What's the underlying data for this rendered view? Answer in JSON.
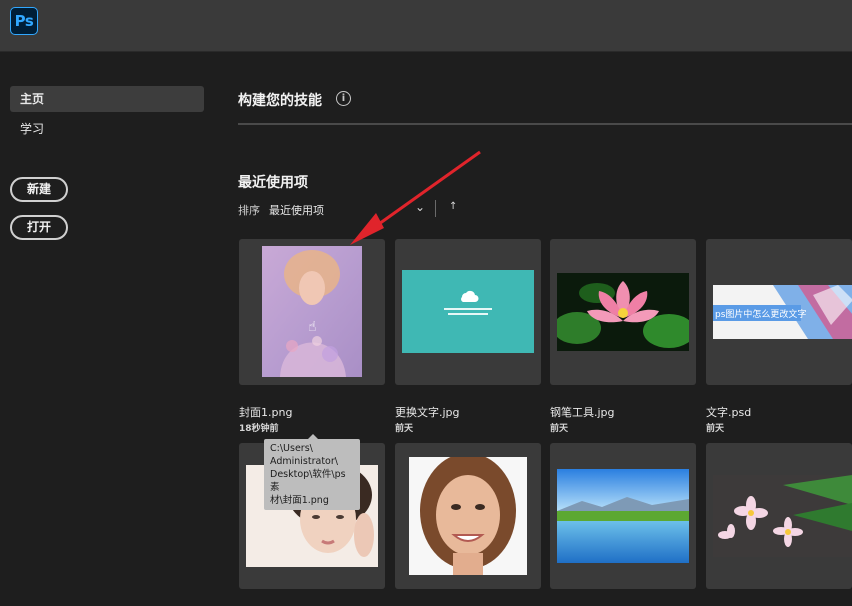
{
  "app": {
    "logo_text": "Ps"
  },
  "sidebar": {
    "items": [
      {
        "label": "主页",
        "active": true
      },
      {
        "label": "学习",
        "active": false
      }
    ],
    "new_button": "新建",
    "open_button": "打开"
  },
  "main": {
    "skills_title": "构建您的技能",
    "info_icon_glyph": "i",
    "recent_title": "最近使用项",
    "sort_label": "排序",
    "sort_value": "最近使用项",
    "sort_chevron": "⌄",
    "sort_direction": "↑"
  },
  "files": [
    {
      "name": "封面1.png",
      "time": "18秒钟前"
    },
    {
      "name": "更换文字.jpg",
      "time": "前天"
    },
    {
      "name": "钢笔工具.jpg",
      "time": "前天"
    },
    {
      "name": "文字.psd",
      "time": "前天"
    }
  ],
  "thumb_text": {
    "wenzi_caption": "ps图片中怎么更改文字"
  },
  "tooltip": {
    "lines": [
      "C:\\Users\\",
      "Administrator\\",
      "Desktop\\软件\\ps素",
      "材\\封面1.png"
    ]
  },
  "colors": {
    "accent_arrow": "#e0242b",
    "ps_blue": "#31a8ff",
    "teal_thumb": "#3fb8b4"
  }
}
